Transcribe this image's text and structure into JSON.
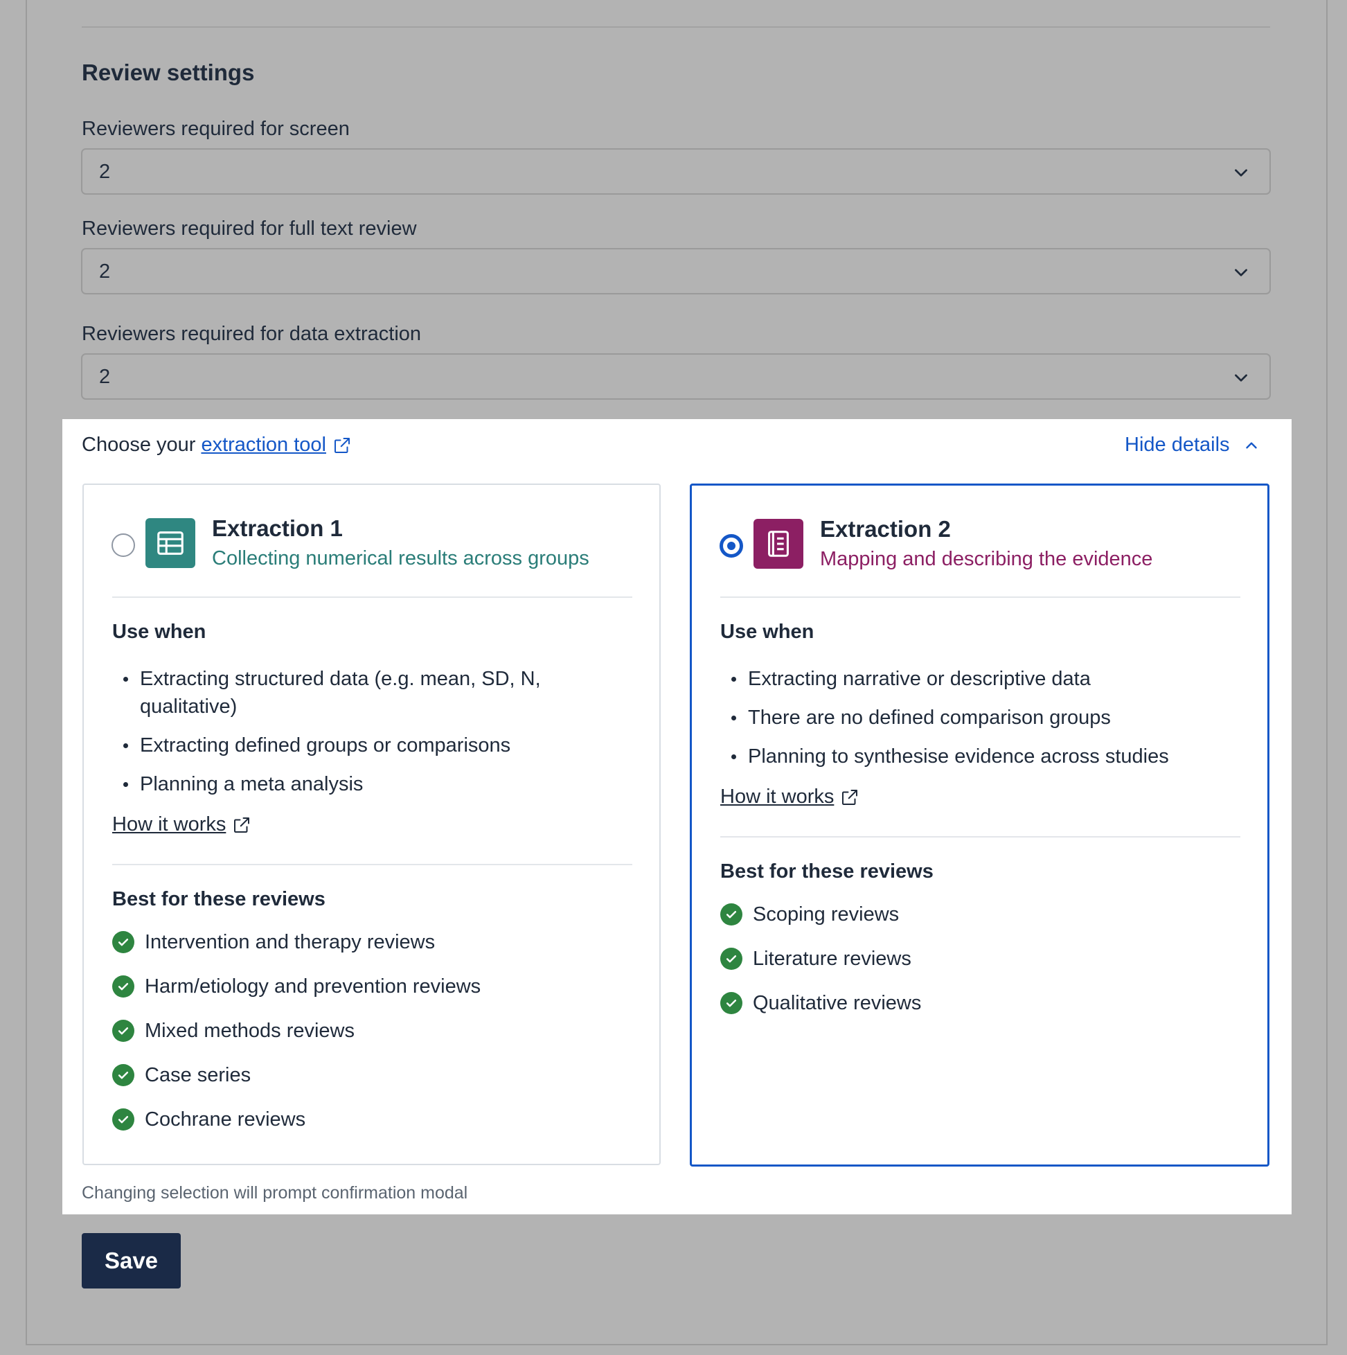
{
  "review_settings": {
    "title": "Review settings",
    "fields": [
      {
        "label": "Reviewers required for screen",
        "value": "2"
      },
      {
        "label": "Reviewers required for full text review",
        "value": "2"
      },
      {
        "label": "Reviewers required for data extraction",
        "value": "2"
      }
    ]
  },
  "extraction": {
    "choose_prefix": "Choose your",
    "choose_link": "extraction tool",
    "hide_details": "Hide details",
    "note": "Changing selection will prompt confirmation modal",
    "cards": [
      {
        "title": "Extraction 1",
        "subtitle": "Collecting numerical results across groups",
        "selected": false,
        "icon": "table-icon",
        "accent": "#2f8781",
        "use_when_heading": "Use when",
        "use_when": [
          "Extracting structured data (e.g. mean, SD, N, qualitative)",
          "Extracting defined groups or comparisons",
          "Planning a meta analysis"
        ],
        "how_it_works": "How it works",
        "best_heading": "Best for these reviews",
        "best_for": [
          "Intervention and therapy reviews",
          "Harm/etiology and prevention reviews",
          "Mixed methods reviews",
          "Case series",
          "Cochrane reviews"
        ]
      },
      {
        "title": "Extraction 2",
        "subtitle": "Mapping and describing the evidence",
        "selected": true,
        "icon": "notebook-icon",
        "accent": "#8c1f63",
        "use_when_heading": "Use when",
        "use_when": [
          "Extracting narrative or descriptive data",
          "There are no defined comparison groups",
          "Planning to synthesise evidence across studies"
        ],
        "how_it_works": "How it works",
        "best_heading": "Best for these reviews",
        "best_for": [
          "Scoping reviews",
          "Literature reviews",
          "Qualitative reviews"
        ]
      }
    ]
  },
  "actions": {
    "save_label": "Save"
  },
  "colors": {
    "link": "#1457c7",
    "selected_border": "#1457c7",
    "check": "#2e8540",
    "save_bg": "#1a2a47"
  }
}
